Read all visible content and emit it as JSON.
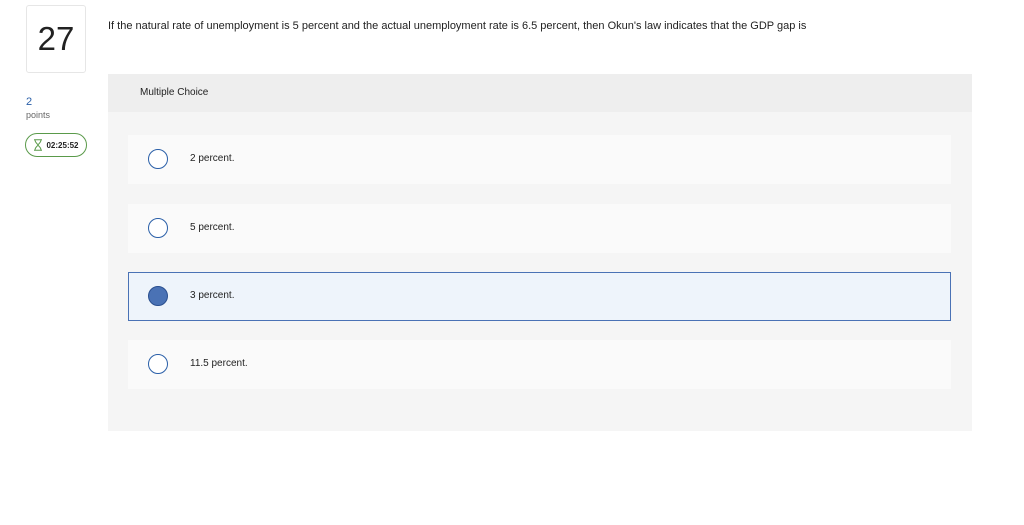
{
  "question": {
    "number": "27",
    "points_value": "2",
    "points_label": "points",
    "timer": "02:25:52",
    "text": "If the natural rate of unemployment is 5 percent and the actual unemployment rate is 6.5 percent, then Okun's law indicates that the GDP gap is"
  },
  "answer_section": {
    "type_label": "Multiple Choice",
    "options": [
      {
        "label": "2 percent.",
        "selected": false
      },
      {
        "label": "5 percent.",
        "selected": false
      },
      {
        "label": "3 percent.",
        "selected": true
      },
      {
        "label": "11.5 percent.",
        "selected": false
      }
    ]
  },
  "colors": {
    "accent": "#2a5fa8",
    "selected_fill": "#4a72b5",
    "timer_border": "#5a9a4a"
  }
}
